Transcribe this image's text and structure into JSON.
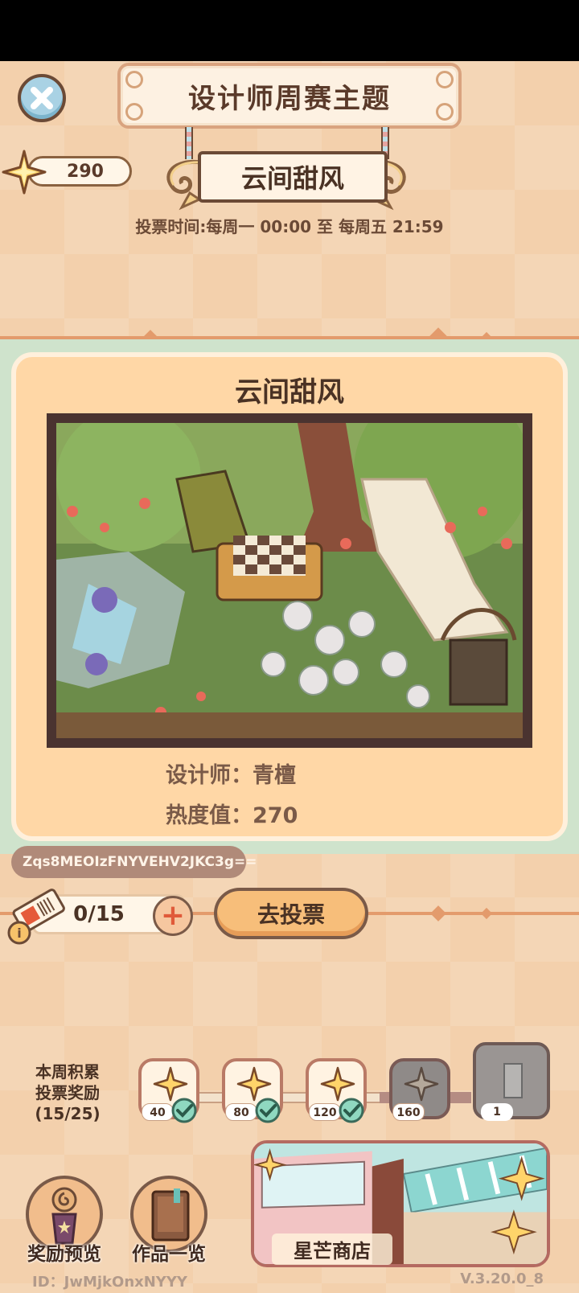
{
  "header": {
    "title": "设计师周赛主题",
    "theme_name": "云间甜风",
    "vote_time": "投票时间:每周一 00:00 至 每周五 21:59",
    "star_count": "290"
  },
  "entry": {
    "title": "云间甜风",
    "designer": "设计师：青檀",
    "heat": "热度值：270",
    "share_code": "Zqs8MEOIzFNYVEHV2JKC3g=="
  },
  "vote": {
    "tickets": "0/15",
    "plus_label": "+",
    "vote_button": "去投票"
  },
  "rewards": {
    "label_line1": "本周积累",
    "label_line2": "投票奖励",
    "label_line3": "(15/25)",
    "milestones": [
      {
        "value": "40",
        "claimed": true
      },
      {
        "value": "80",
        "claimed": true
      },
      {
        "value": "120",
        "claimed": true
      },
      {
        "value": "160",
        "claimed": false
      },
      {
        "value": "1",
        "claimed": false
      }
    ]
  },
  "bottom": {
    "reward_preview": "奖励预览",
    "works_list": "作品一览",
    "shop": "星芒商店"
  },
  "footer": {
    "id": "ID：JwMjkOnxNYYY",
    "version": "V.3.20.0_8"
  },
  "colors": {
    "accent": "#e39b6c",
    "card_bg": "#ffd7a6",
    "button": "#f7be7a"
  }
}
